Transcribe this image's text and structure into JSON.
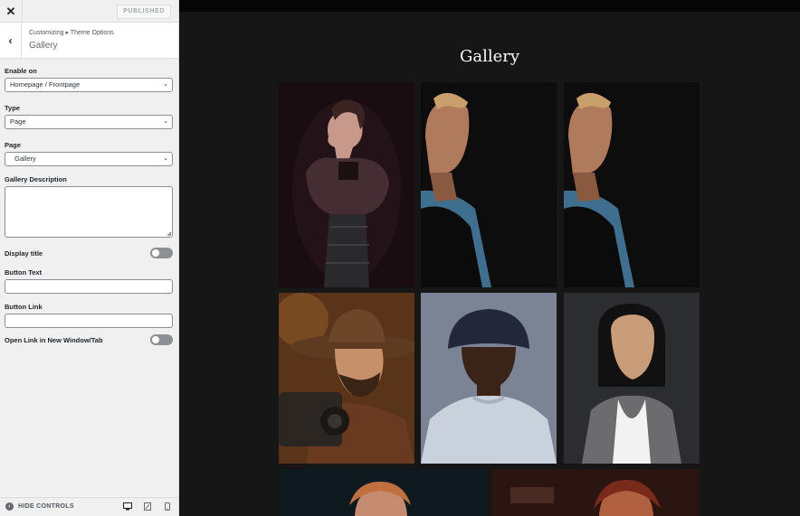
{
  "topbar": {
    "close_label": "✕",
    "publish_label": "PUBLISHED"
  },
  "section": {
    "back_label": "‹",
    "breadcrumb": "Customizing ▸ Theme Options",
    "title": "Gallery"
  },
  "controls": {
    "enable_on": {
      "label": "Enable on",
      "value": "Homepage / Frontpage"
    },
    "type": {
      "label": "Type",
      "value": "Page"
    },
    "page": {
      "label": "Page",
      "value": "Gallery"
    },
    "description": {
      "label": "Gallery Description",
      "value": ""
    },
    "display_title": {
      "label": "Display title",
      "enabled": false
    },
    "button_text": {
      "label": "Button Text",
      "value": ""
    },
    "button_link": {
      "label": "Button Link",
      "value": ""
    },
    "new_window": {
      "label": "Open Link in New Window/Tab",
      "enabled": false
    }
  },
  "footer": {
    "hide_label": "HIDE CONTROLS",
    "devices": [
      "desktop-icon",
      "tablet-icon",
      "mobile-icon"
    ]
  },
  "preview": {
    "heading": "Gallery",
    "photos": [
      "woman-sheer-blouse-dark-backdrop",
      "man-profile-blue-shirt",
      "man-profile-blue-shirt-duplicate",
      "bearded-man-hat-camera",
      "man-bucket-hat-gray-sweater",
      "woman-gray-coat",
      "woman-partial-bottom-left",
      "woman-partial-bottom-right"
    ]
  },
  "colors": {
    "sidebar_bg": "#f0f0f1",
    "preview_bg": "#161616",
    "accent": "#1d2327"
  }
}
